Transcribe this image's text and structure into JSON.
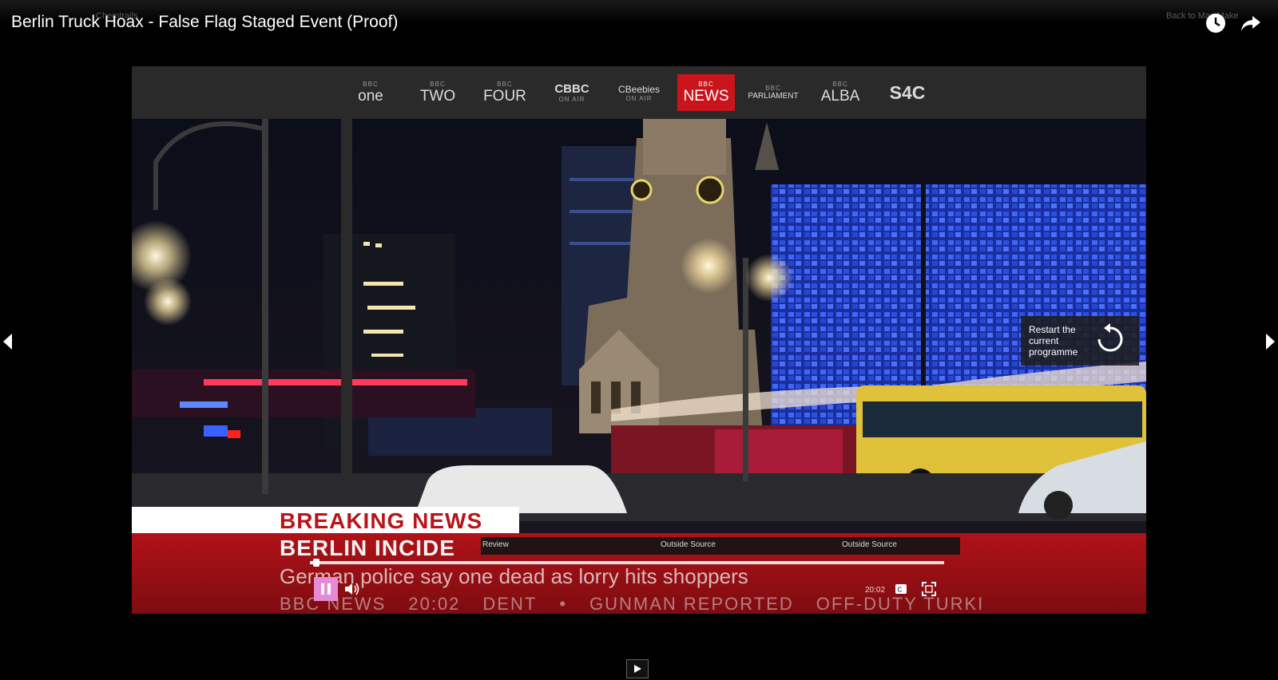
{
  "window": {
    "ghost_breadcrumb": "Chemtrails",
    "ghost_right": "Back to Mac Make",
    "title": "Berlin Truck Hoax - False Flag Staged Event (Proof)"
  },
  "icons": {
    "watch_later": "clock-icon",
    "share": "share-arrow-icon",
    "prev": "chevron-left-icon",
    "next": "chevron-right-icon",
    "restart": "restart-icon",
    "volume": "volume-icon",
    "captions": "captions-icon",
    "fullscreen": "fullscreen-icon",
    "play": "play-icon"
  },
  "channels": [
    {
      "sub": "BBC",
      "label": "one"
    },
    {
      "sub": "BBC",
      "label": "TWO"
    },
    {
      "sub": "BBC",
      "label": "FOUR"
    },
    {
      "sub": "CBBC",
      "label": "ON AIR"
    },
    {
      "sub": "CBeebies",
      "label": "ON AIR"
    },
    {
      "sub": "BBC",
      "label": "NEWS"
    },
    {
      "sub": "BBC",
      "label": "PARLIAMENT"
    },
    {
      "sub": "BBC",
      "label": "ALBA"
    },
    {
      "sub": "",
      "label": "S4C"
    }
  ],
  "restart": {
    "label": "Restart the current programme"
  },
  "news": {
    "banner": "BREAKING NEWS",
    "headline": "BERLIN INCIDE",
    "subline": "German police say one dead as lorry hits shoppers",
    "ticker": [
      "BBC NEWS",
      "20:02",
      "DENT",
      "•",
      "GUNMAN REPORTED",
      "OFF-DUTY TURKI"
    ]
  },
  "player": {
    "chapters": [
      "Review",
      "Outside Source",
      "Outside Source"
    ],
    "time": "20:02",
    "progress": 0.01
  },
  "colors": {
    "news_red": "#c8141a",
    "pause_pink": "#e68ad5"
  }
}
